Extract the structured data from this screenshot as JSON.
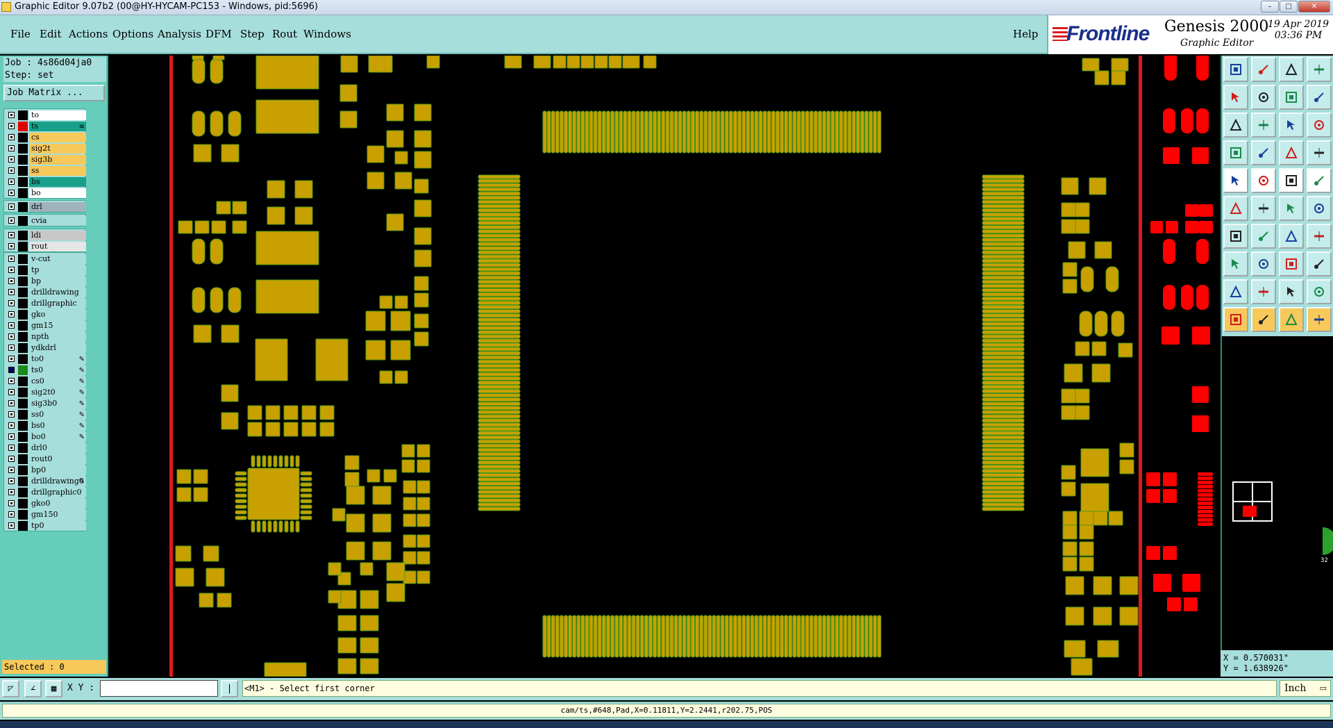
{
  "window": {
    "title": "Graphic Editor 9.07b2 (00@HY-HYCAM-PC153 - Windows, pid:5696)",
    "controls": [
      "–",
      "□",
      "✕"
    ]
  },
  "menu": {
    "items": [
      "File",
      "Edit",
      "Actions",
      "Options",
      "Analysis",
      "DFM",
      "Step",
      "Rout",
      "Windows"
    ],
    "help": "Help"
  },
  "brand": {
    "logo": "Frontline",
    "product": "Genesis 2000",
    "subtitle": "Graphic Editor",
    "date": "19 Apr 2019",
    "time": "03:36 PM"
  },
  "job": {
    "job_label": "Job : 4s86d04ja0",
    "step_label": "Step: set",
    "matrix_button": "Job Matrix ..."
  },
  "layer_groups": [
    [
      {
        "name": "to",
        "color": "#ffffff",
        "swatch": "#000000"
      },
      {
        "name": "ts",
        "color": "#18a08a",
        "swatch": "#e00000",
        "mark": "≡"
      },
      {
        "name": "cs",
        "color": "#f7c85a",
        "swatch": "#000000"
      },
      {
        "name": "sig2t",
        "color": "#f7c85a",
        "swatch": "#000000"
      },
      {
        "name": "sig3b",
        "color": "#f7c85a",
        "swatch": "#000000"
      },
      {
        "name": "ss",
        "color": "#f7c85a",
        "swatch": "#000000"
      },
      {
        "name": "bs",
        "color": "#18a08a",
        "swatch": "#000000"
      },
      {
        "name": "bo",
        "color": "#ffffff",
        "swatch": "#000000"
      }
    ],
    [
      {
        "name": "drl",
        "color": "#9fb3bd",
        "swatch": "#000000"
      }
    ],
    [
      {
        "name": "cvia",
        "color": "#a6dedb",
        "swatch": "#000000"
      }
    ],
    [
      {
        "name": "ldi",
        "color": "#c8c8c8",
        "swatch": "#000000"
      },
      {
        "name": "rout",
        "color": "#e6e6e6",
        "swatch": "#000000"
      }
    ],
    [
      {
        "name": "v-cut",
        "color": "#a6dedb",
        "swatch": "#000000"
      },
      {
        "name": "tp",
        "color": "#a6dedb",
        "swatch": "#000000"
      },
      {
        "name": "bp",
        "color": "#a6dedb",
        "swatch": "#000000"
      },
      {
        "name": "drilldrawing",
        "color": "#a6dedb",
        "swatch": "#000000"
      },
      {
        "name": "drillgraphic",
        "color": "#a6dedb",
        "swatch": "#000000"
      },
      {
        "name": "gko",
        "color": "#a6dedb",
        "swatch": "#000000"
      },
      {
        "name": "gm15",
        "color": "#a6dedb",
        "swatch": "#000000"
      },
      {
        "name": "npth",
        "color": "#a6dedb",
        "swatch": "#000000"
      },
      {
        "name": "ydkdrl",
        "color": "#a6dedb",
        "swatch": "#000000"
      },
      {
        "name": "to0",
        "color": "#a6dedb",
        "swatch": "#000000",
        "mark": "✎"
      },
      {
        "name": "ts0",
        "color": "#a6dedb",
        "swatch": "#1a8a1a",
        "mark": "✎",
        "checked_color": "#000080"
      },
      {
        "name": "cs0",
        "color": "#a6dedb",
        "swatch": "#000000",
        "mark": "✎"
      },
      {
        "name": "sig2t0",
        "color": "#a6dedb",
        "swatch": "#000000",
        "mark": "✎"
      },
      {
        "name": "sig3b0",
        "color": "#a6dedb",
        "swatch": "#000000",
        "mark": "✎"
      },
      {
        "name": "ss0",
        "color": "#a6dedb",
        "swatch": "#000000",
        "mark": "✎"
      },
      {
        "name": "bs0",
        "color": "#a6dedb",
        "swatch": "#000000",
        "mark": "✎"
      },
      {
        "name": "bo0",
        "color": "#a6dedb",
        "swatch": "#000000",
        "mark": "✎"
      },
      {
        "name": "drl0",
        "color": "#a6dedb",
        "swatch": "#000000"
      },
      {
        "name": "rout0",
        "color": "#a6dedb",
        "swatch": "#000000"
      },
      {
        "name": "bp0",
        "color": "#a6dedb",
        "swatch": "#000000"
      },
      {
        "name": "drilldrawing0",
        "color": "#a6dedb",
        "swatch": "#000000",
        "mark": "✎"
      },
      {
        "name": "drillgraphic0",
        "color": "#a6dedb",
        "swatch": "#000000"
      },
      {
        "name": "gko0",
        "color": "#a6dedb",
        "swatch": "#000000"
      },
      {
        "name": "gm150",
        "color": "#a6dedb",
        "swatch": "#000000"
      },
      {
        "name": "tp0",
        "color": "#a6dedb",
        "swatch": "#000000"
      }
    ]
  ],
  "selected_label": "Selected : 0",
  "colors": {
    "pad": "#c8a000",
    "pad_outline": "#4f9a1a",
    "board_edge": "#e01a1a",
    "red_layer": "#ff0000",
    "panel": "#a6dedb"
  },
  "tool_icons": [
    "zoom-home-icon",
    "zoom-in-icon",
    "home-icon",
    "grid-icon",
    "pan-left-icon",
    "pan-right-icon",
    "redraw-icon",
    "snap-icon",
    "fit-icon",
    "center-icon",
    "scale-1-2-icon",
    "help-icon",
    "measure-icon",
    "ruler-icon",
    "layers-icon",
    "net-icon",
    "add-pad-icon",
    "draw-shape-icon",
    "text-icon",
    "circle-icon",
    "move-icon",
    "cross-icon",
    "connect-icon",
    "line-icon",
    "edge-icon",
    "slash-icon",
    "arc-icon",
    "split-icon",
    "copy-icon",
    "line-red-icon",
    "resize-icon",
    "group-icon",
    "triangle-icon",
    "triangle-select-icon",
    "triangle-edit-icon",
    "triangle-mode-icon",
    "pointer-icon",
    "pointer-select-icon",
    "pointer-edit-icon",
    "pointer-route-icon"
  ],
  "coords": {
    "x": "X = 0.570031\"",
    "y": "Y = 1.638926\""
  },
  "bottom": {
    "xy_label": "X Y :",
    "xy_value": "",
    "prompt": "<M1> - Select first corner",
    "unit": "Inch"
  },
  "status": "cam/ts,#648,Pad,X=0.11811,Y=2.2441,r202.75,POS",
  "mini_badge": "32"
}
